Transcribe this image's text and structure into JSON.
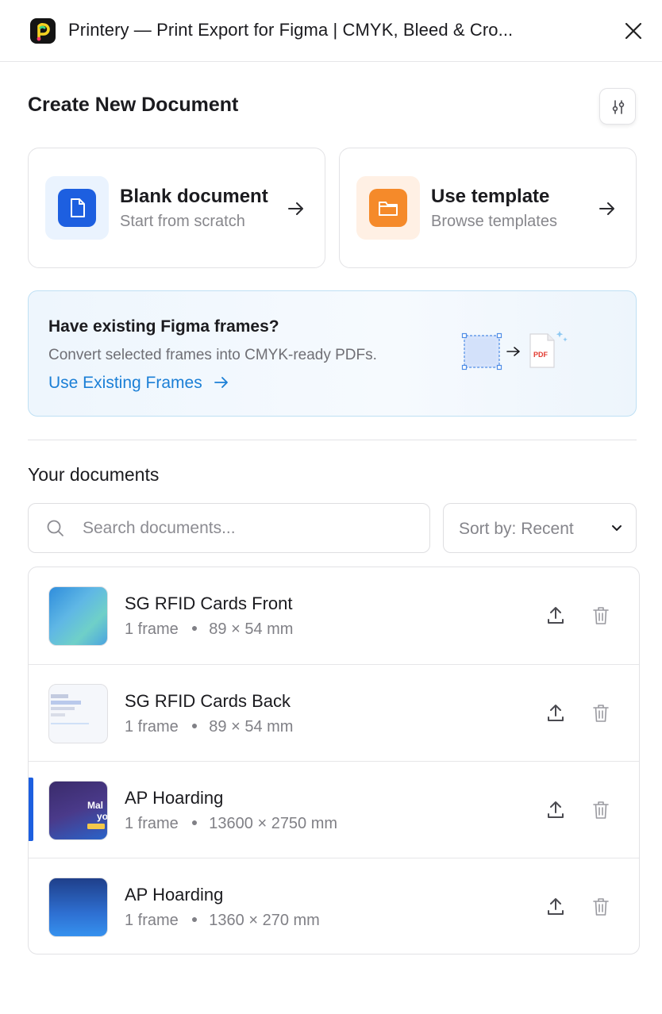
{
  "window": {
    "title": "Printery — Print Export for Figma | CMYK, Bleed & Cro...",
    "close_icon": "close-icon"
  },
  "create": {
    "heading": "Create New Document",
    "settings_icon": "sliders-icon",
    "cards": [
      {
        "title": "Blank document",
        "subtitle": "Start from scratch",
        "icon": "document-icon",
        "accent": "#1d5fe0"
      },
      {
        "title": "Use template",
        "subtitle": "Browse templates",
        "icon": "folder-icon",
        "accent": "#f58a2a"
      }
    ]
  },
  "banner": {
    "title": "Have existing Figma frames?",
    "description": "Convert selected frames into CMYK-ready PDFs.",
    "link_label": "Use Existing Frames",
    "pdf_label": "PDF",
    "link_color": "#1b7fd6"
  },
  "documents": {
    "heading": "Your documents",
    "search_placeholder": "Search documents...",
    "sort_label": "Sort by: Recent",
    "items": [
      {
        "name": "SG RFID Cards Front",
        "frames": "1 frame",
        "size": "89 × 54 mm",
        "selected": false
      },
      {
        "name": "SG RFID Cards Back",
        "frames": "1 frame",
        "size": "89 × 54 mm",
        "selected": false
      },
      {
        "name": "AP Hoarding",
        "frames": "1 frame",
        "size": "13600 × 2750 mm",
        "selected": true
      },
      {
        "name": "AP Hoarding",
        "frames": "1 frame",
        "size": "1360 × 270 mm",
        "selected": false
      }
    ]
  }
}
